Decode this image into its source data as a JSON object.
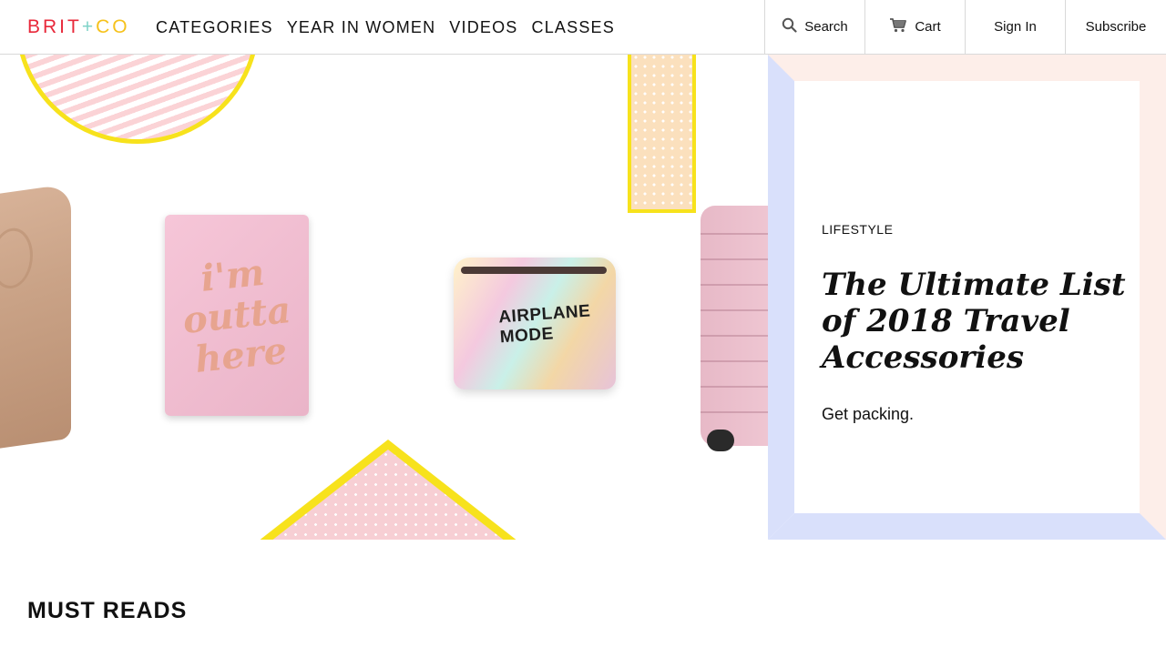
{
  "header": {
    "logo": {
      "part1": "BRIT",
      "plus": "+",
      "part2": "CO"
    },
    "nav": [
      "CATEGORIES",
      "YEAR IN WOMEN",
      "VIDEOS",
      "CLASSES"
    ],
    "utility": {
      "search_label": "Search",
      "search_icon": "search-icon",
      "cart_label": "Cart",
      "cart_icon": "cart-icon",
      "signin_label": "Sign In",
      "subscribe_label": "Subscribe"
    }
  },
  "hero": {
    "art": {
      "passport_text": "i'm outta here",
      "pouch_text": "AIRPLANE MODE"
    },
    "card": {
      "category": "LIFESTYLE",
      "title": "The Ultimate List of 2018 Travel Accessories",
      "dek": "Get packing."
    }
  },
  "must_reads": {
    "heading": "MUST READS"
  },
  "colors": {
    "logo_brit": "#e8283a",
    "logo_plus": "#7fd3c8",
    "logo_co": "#f6c21c",
    "frame_peach": "#fdeee9",
    "frame_blue": "#d9e0fb",
    "accent_yellow": "#f7e21c",
    "accent_pink": "#fbd3d6"
  }
}
